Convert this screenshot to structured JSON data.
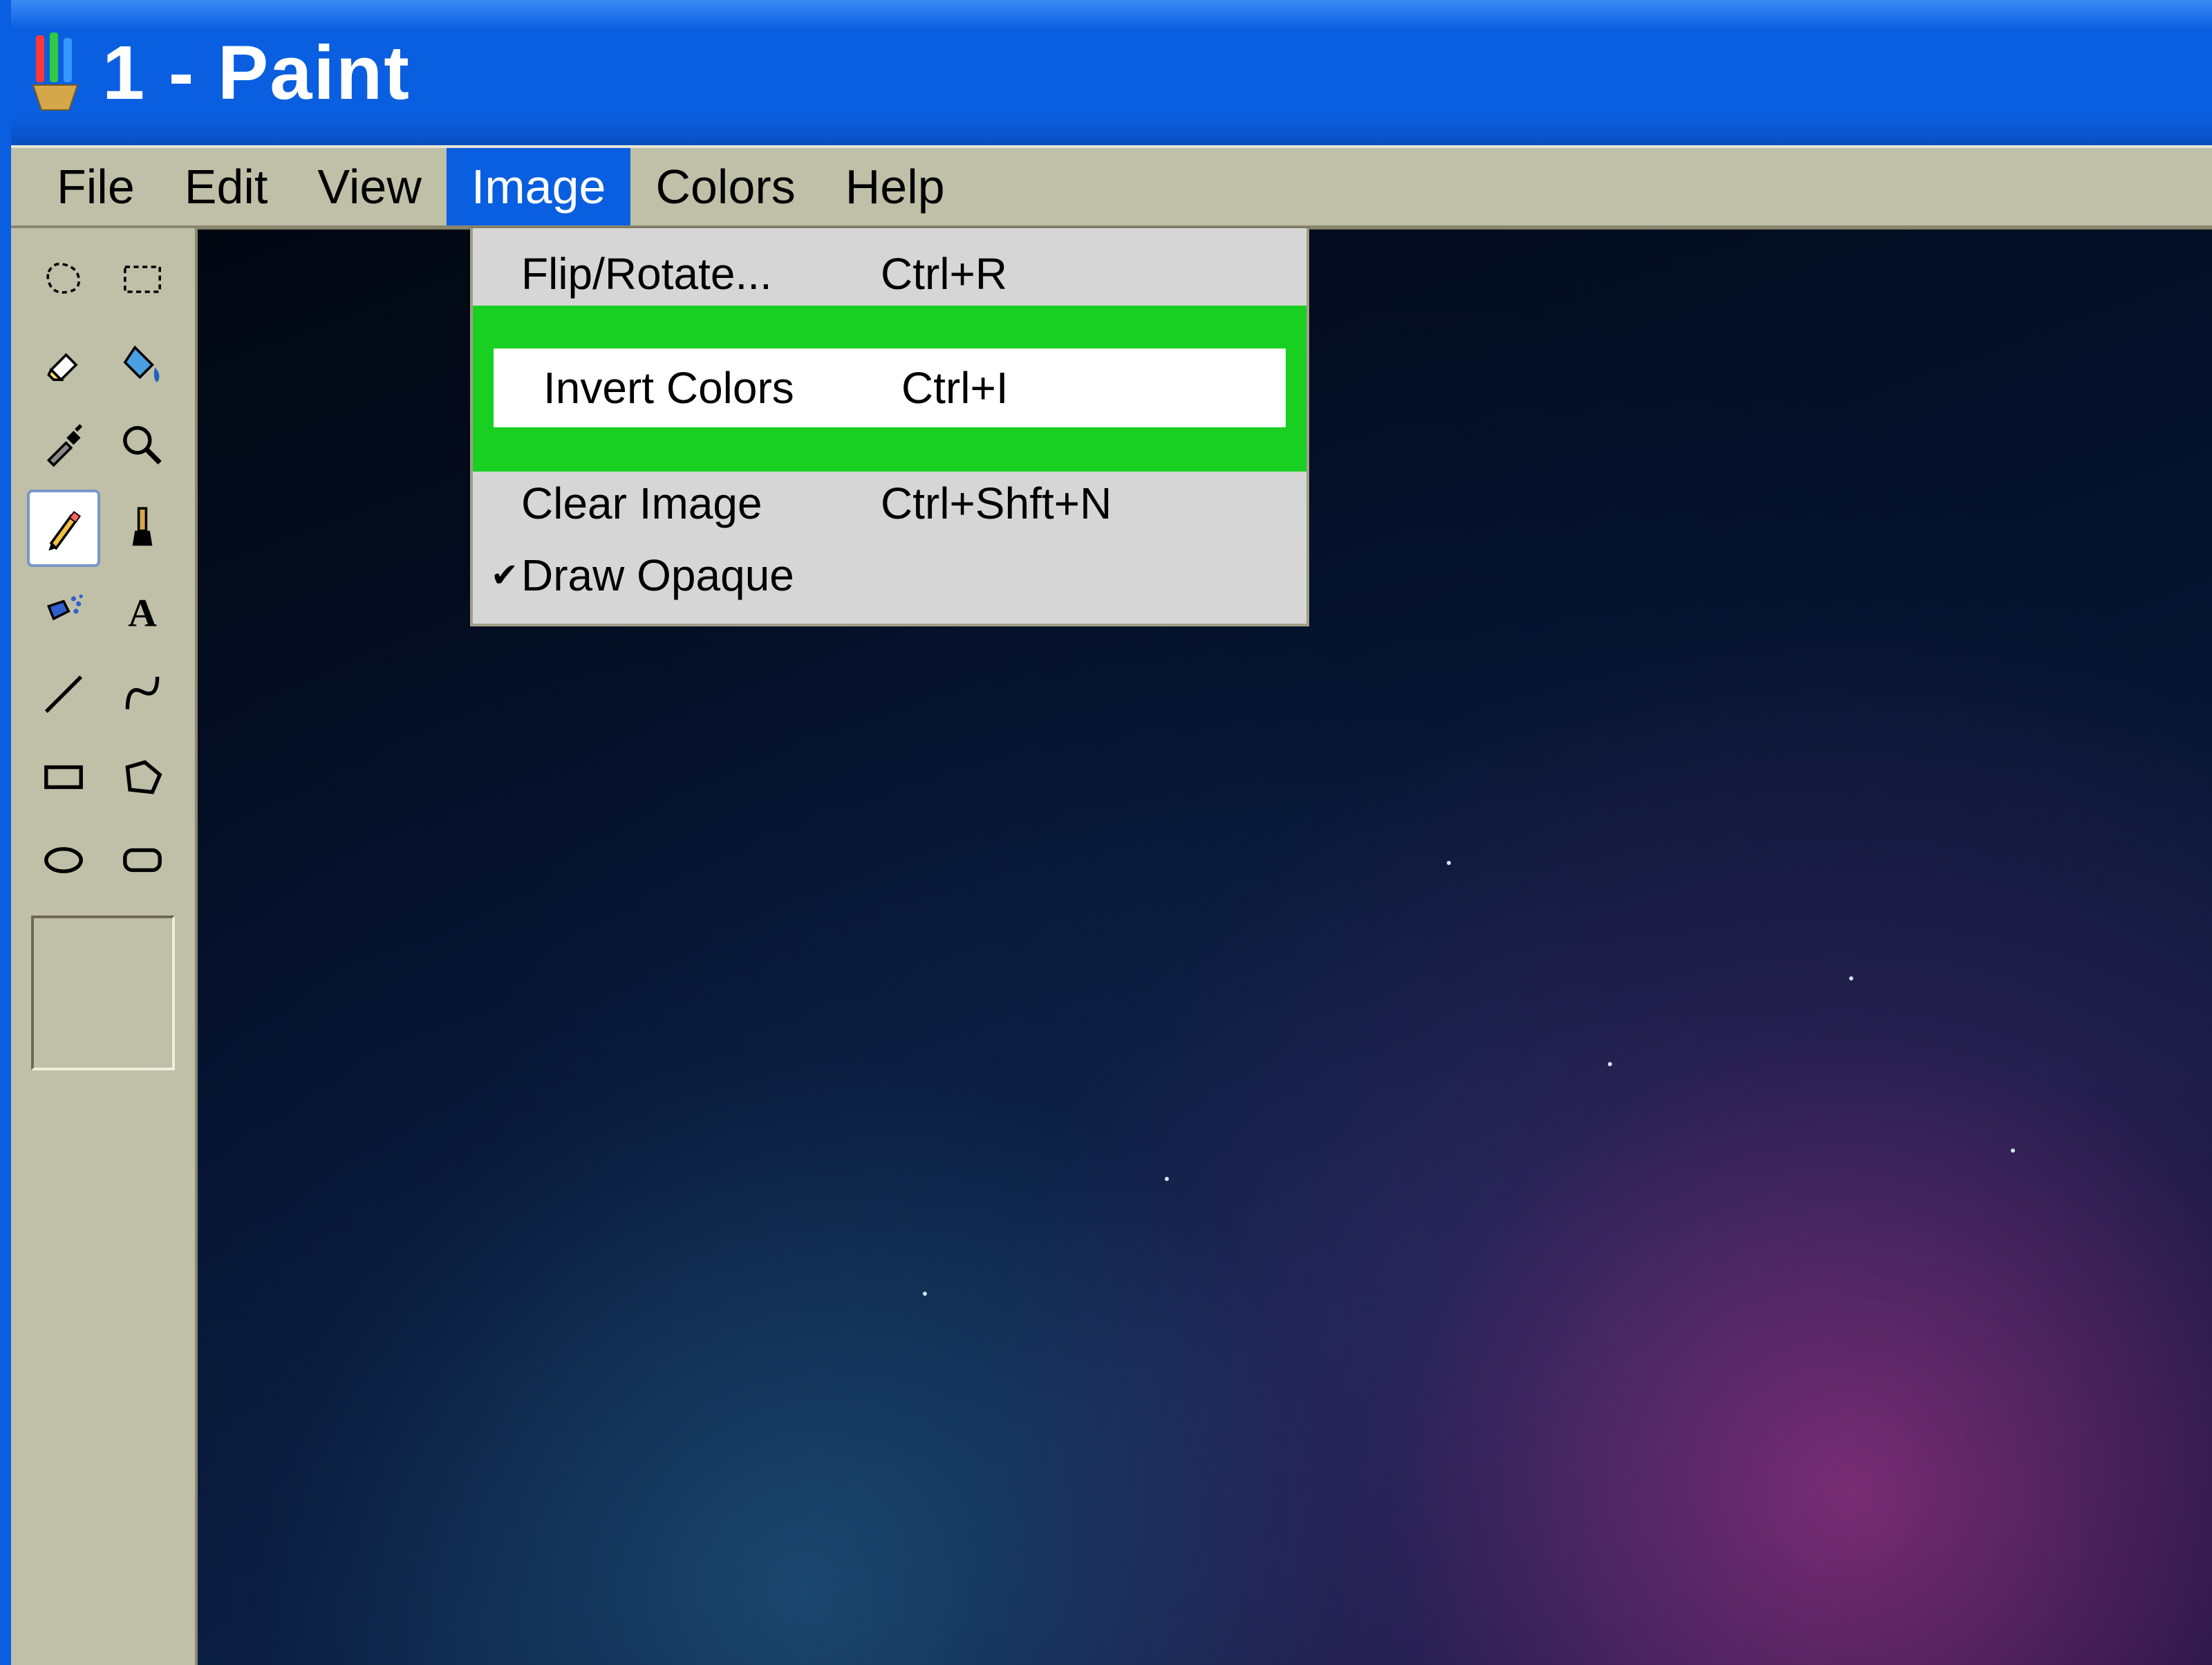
{
  "window": {
    "title": "1 - Paint"
  },
  "menubar": {
    "file": "File",
    "edit": "Edit",
    "view": "View",
    "image": "Image",
    "colors": "Colors",
    "help": "Help",
    "active": "image"
  },
  "dropdown": {
    "flip_rotate": {
      "label": "Flip/Rotate...",
      "shortcut": "Ctrl+R"
    },
    "invert_colors": {
      "label": "Invert Colors",
      "shortcut": "Ctrl+I",
      "highlighted": true
    },
    "clear_image": {
      "label": "Clear Image",
      "shortcut": "Ctrl+Shft+N"
    },
    "draw_opaque": {
      "label": "Draw Opaque",
      "checked": true
    }
  },
  "tools": [
    "free-form-select",
    "rectangle-select",
    "eraser",
    "fill",
    "color-picker",
    "magnifier",
    "pencil",
    "brush",
    "airbrush",
    "text",
    "line",
    "curve",
    "rectangle",
    "polygon",
    "ellipse",
    "rounded-rectangle"
  ],
  "selected_tool": "pencil",
  "colors": {
    "title_bar": "#0a5fe0",
    "highlight": "#18cf22",
    "chrome": "#c0c0a8"
  }
}
